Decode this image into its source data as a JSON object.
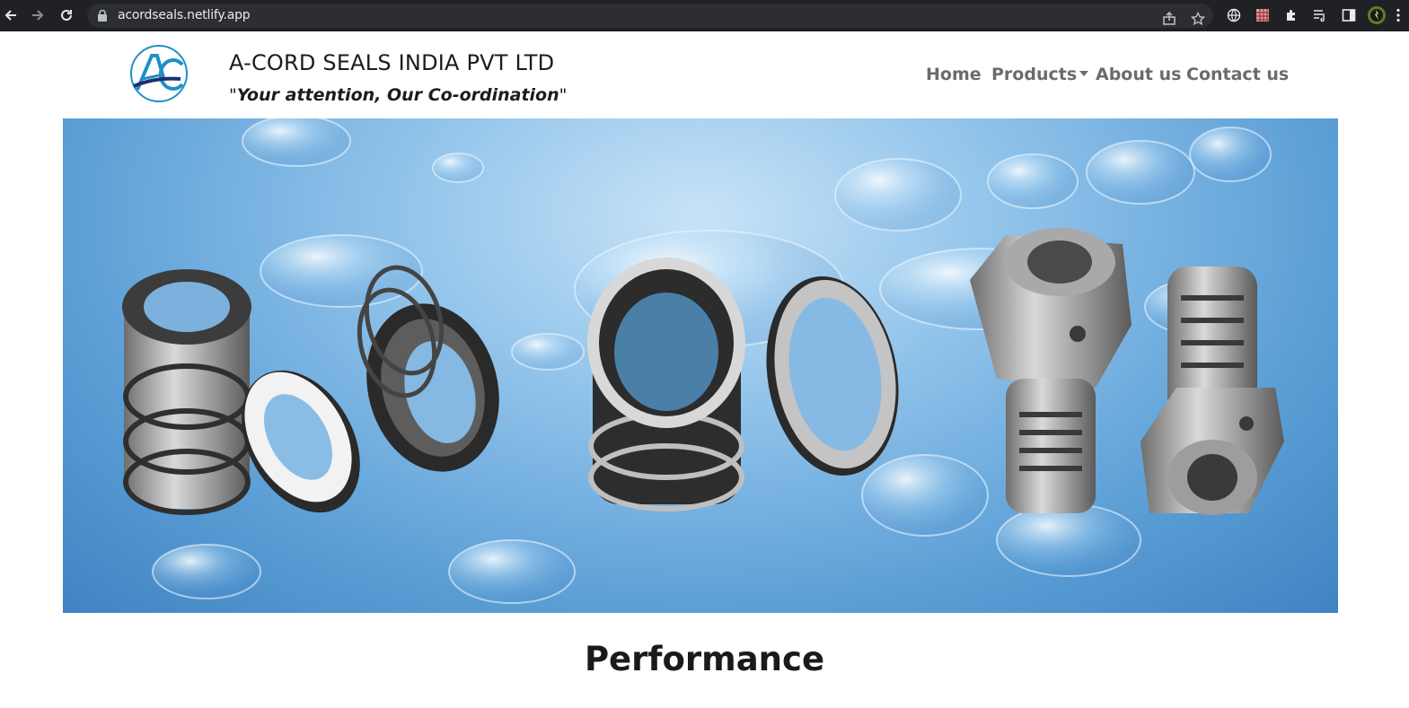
{
  "browser": {
    "url": "acordseals.netlify.app"
  },
  "site": {
    "brand_name": "A-CORD SEALS INDIA PVT LTD",
    "tagline_quote_open": "\"",
    "tagline_text": "Your attention, Our Co-ordination",
    "tagline_quote_close": "\"",
    "logo_letters": "AC"
  },
  "nav": {
    "items": [
      {
        "label": "Home"
      },
      {
        "label": "Products"
      },
      {
        "label": "About us"
      },
      {
        "label": "Contact us"
      }
    ]
  },
  "hero": {
    "image_name": "mechanical-seals-banner"
  },
  "section": {
    "heading": "Performance"
  },
  "colors": {
    "chrome_bg": "#202124",
    "nav_text": "#6b6b6b",
    "logo_blue": "#1f8fc9"
  }
}
